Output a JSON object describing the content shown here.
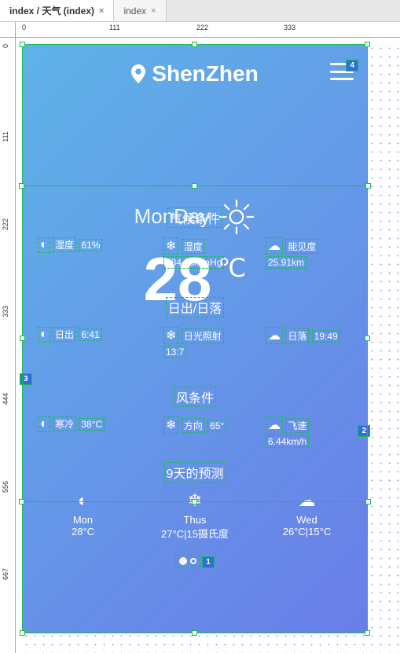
{
  "tabs": [
    {
      "label": "index / 天气 (index)",
      "active": true
    },
    {
      "label": "index",
      "active": false
    }
  ],
  "ruler_h": [
    "0",
    "111",
    "222",
    "333"
  ],
  "ruler_v": [
    "0",
    "111",
    "222",
    "333",
    "444",
    "556",
    "667"
  ],
  "header": {
    "city": "ShenZhen"
  },
  "hero": {
    "day": "MonDay",
    "temp": "28",
    "unit": "℃"
  },
  "badges": {
    "menu": "4",
    "left": "3",
    "right": "2",
    "dots": "1"
  },
  "section1": {
    "title": "气候条件",
    "items": [
      {
        "glyph": "◐",
        "label": "湿度",
        "value": "61%"
      },
      {
        "glyph": "❄",
        "label": "湿度",
        "value": "784.3cmmHg"
      },
      {
        "glyph": "☁",
        "label": "能见度",
        "value": "25.91km"
      }
    ]
  },
  "section2": {
    "title": "日出/日落",
    "items": [
      {
        "glyph": "◐",
        "label": "日出",
        "value": "6:41"
      },
      {
        "glyph": "❄",
        "label": "日光照射",
        "value": "13:7"
      },
      {
        "glyph": "☁",
        "label": "日落",
        "value": "19:49"
      }
    ]
  },
  "section3": {
    "title": "风条件",
    "items": [
      {
        "glyph": "◐",
        "label": "寒冷",
        "value": "38°C"
      },
      {
        "glyph": "❄",
        "label": "方向",
        "value": "65°"
      },
      {
        "glyph": "☁",
        "label": "飞速",
        "value": "6.44km/h"
      }
    ]
  },
  "forecast": {
    "title": "9天的预测",
    "days": [
      {
        "glyph": "◐",
        "name": "Mon",
        "temp": "28°C"
      },
      {
        "glyph": "❄",
        "name": "Thus",
        "temp": "27°C|15摄氏度"
      },
      {
        "glyph": "☁",
        "name": "Wed",
        "temp": "26°C|15°C"
      }
    ]
  }
}
